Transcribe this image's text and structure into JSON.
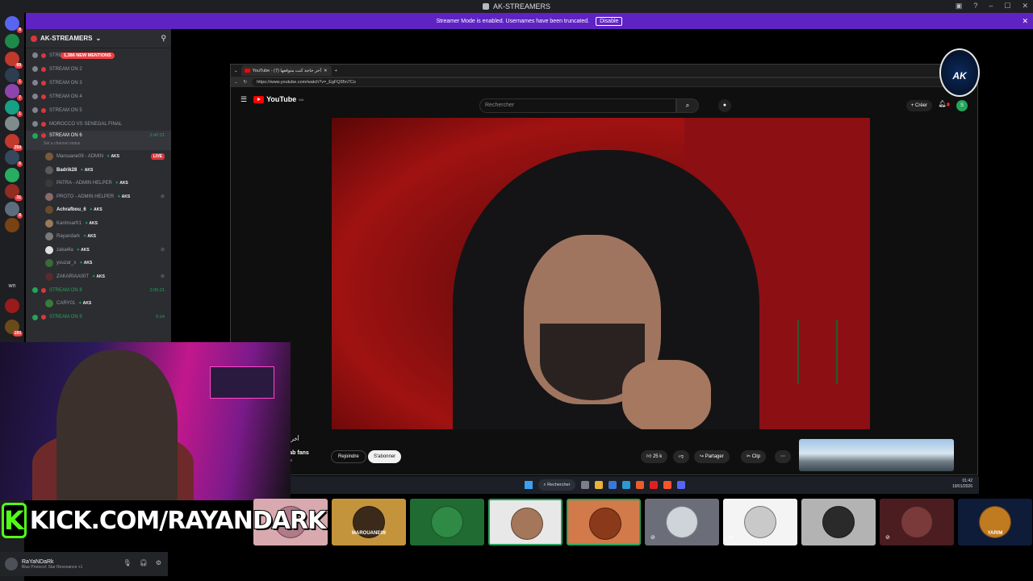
{
  "window": {
    "title": "AK-STREAMERS"
  },
  "banner": {
    "text": "Streamer Mode is enabled. Usernames have been truncated.",
    "button": "Disable"
  },
  "rail": {
    "servers": [
      {
        "color": "#5865f2",
        "badge": "8"
      },
      {
        "color": "#1e8a4a",
        "badge": ""
      },
      {
        "color": "#c0392b",
        "badge": "69"
      },
      {
        "color": "#2c3e50",
        "badge": "1"
      },
      {
        "color": "#8e44ad",
        "badge": "7"
      },
      {
        "color": "#16a085",
        "badge": "1"
      },
      {
        "color": "#7f8c8d",
        "badge": ""
      },
      {
        "color": "#c0392b",
        "badge": "259"
      },
      {
        "color": "#34495e",
        "badge": "6"
      },
      {
        "color": "#27ae60",
        "badge": ""
      },
      {
        "color": "#922b21",
        "badge": "31"
      },
      {
        "color": "#5d6d7e",
        "badge": "8"
      },
      {
        "color": "#784212",
        "badge": ""
      }
    ],
    "text_server": "wn",
    "bottom_badge": "193"
  },
  "server": {
    "name": "AK-STREAMERS"
  },
  "channels": [
    {
      "name": "STRE",
      "mention": "1,386 NEW MENTIONS"
    },
    {
      "name": "STREAM ON 2"
    },
    {
      "name": "STREAM ON 3"
    },
    {
      "name": "STREAM ON 4"
    },
    {
      "name": "STREAM ON 5"
    },
    {
      "name": "MOROCCO VS SENEGAL FINAL"
    }
  ],
  "active_channel": {
    "name": "STREAM ON 6",
    "time": "2:42:21",
    "status": "Set a channel status"
  },
  "members": [
    {
      "name": "Marouane09 - ADMIN",
      "tag": "AKS",
      "bold": false,
      "live": "LIVE"
    },
    {
      "name": "Badrik28",
      "tag": "AKS",
      "bold": true
    },
    {
      "name": "PATRA - ADMIN HELPER",
      "tag": "AKS",
      "bold": false
    },
    {
      "name": "PROTO - ADMIN HELPER",
      "tag": "AKS",
      "bold": false,
      "mute": true
    },
    {
      "name": "Achrafbou_6",
      "tag": "AKS",
      "bold": true
    },
    {
      "name": "Karimsarfr1",
      "tag": "AKS",
      "bold": false
    },
    {
      "name": "Rayandark",
      "tag": "AKS",
      "bold": false
    },
    {
      "name": "zaka4la",
      "tag": "AKS",
      "bold": false,
      "mute": true
    },
    {
      "name": "youzar_x",
      "tag": "AKS",
      "bold": false
    },
    {
      "name": "ZAKARIAA00T",
      "tag": "AKS",
      "bold": false,
      "mute": true
    }
  ],
  "channel8": {
    "name": "STREAM ON 8",
    "time": "2:05:21",
    "member": "CARY01",
    "tag": "AKS"
  },
  "channel9": {
    "name": "STREAM ON 9",
    "time": "5:14"
  },
  "browser": {
    "tab_title": "YouTube - آخر حاجة كنت متوقعها (7)",
    "url": "https://www.youtube.com/watch?v=_EgFQ95n7Co",
    "logo": "YouTube",
    "region": "MA",
    "search_placeholder": "Rechercher",
    "create": "Créer",
    "notif_count": "7",
    "avatar_letter": "S",
    "video_title": "أخر ح",
    "channel_name": "nab fans",
    "channel_subs": "nés",
    "join": "Rejoindre",
    "subscribe": "S'abonner",
    "likes": "25 k",
    "share": "Partager",
    "clip": "Clip",
    "more": "⋯"
  },
  "taskbar": {
    "search": "Rechercher",
    "time": "01:42",
    "date": "19/01/2026"
  },
  "ak_logo": {
    "text": "AK"
  },
  "kick": {
    "icon": "K",
    "text": "KICK.COM/RAYANDARK"
  },
  "tiles": [
    {
      "color": "#d9a9b0",
      "avatar": "#b07a88",
      "mute": false,
      "name": ""
    },
    {
      "color": "#c4943c",
      "avatar": "#3b2a1a",
      "mute": false,
      "name": "MAROUANE09"
    },
    {
      "color": "#1f6b32",
      "avatar": "#2e8a44",
      "mute": false,
      "name": ""
    },
    {
      "color": "#e8e8e8",
      "avatar": "#a4775a",
      "mute": false,
      "name": "",
      "speaking": true
    },
    {
      "color": "#d27a4a",
      "avatar": "#8a3a1a",
      "mute": false,
      "name": "",
      "speaking": true
    },
    {
      "color": "#6b6e78",
      "avatar": "#cfd3da",
      "mute": true,
      "name": ""
    },
    {
      "color": "#f4f4f4",
      "avatar": "#c9c9c9",
      "mute": true,
      "name": ""
    },
    {
      "color": "#b3b3b3",
      "avatar": "#2a2a2a",
      "mute": false,
      "name": ""
    },
    {
      "color": "#4b1c20",
      "avatar": "#7a3a3a",
      "mute": true,
      "name": ""
    },
    {
      "color": "#0e1c3a",
      "avatar": "#c07a20",
      "mute": false,
      "name": "YARIM"
    }
  ],
  "user": {
    "name": "RaYaNDaRk",
    "status": "Blue Protocol: Star Resonance +1"
  }
}
